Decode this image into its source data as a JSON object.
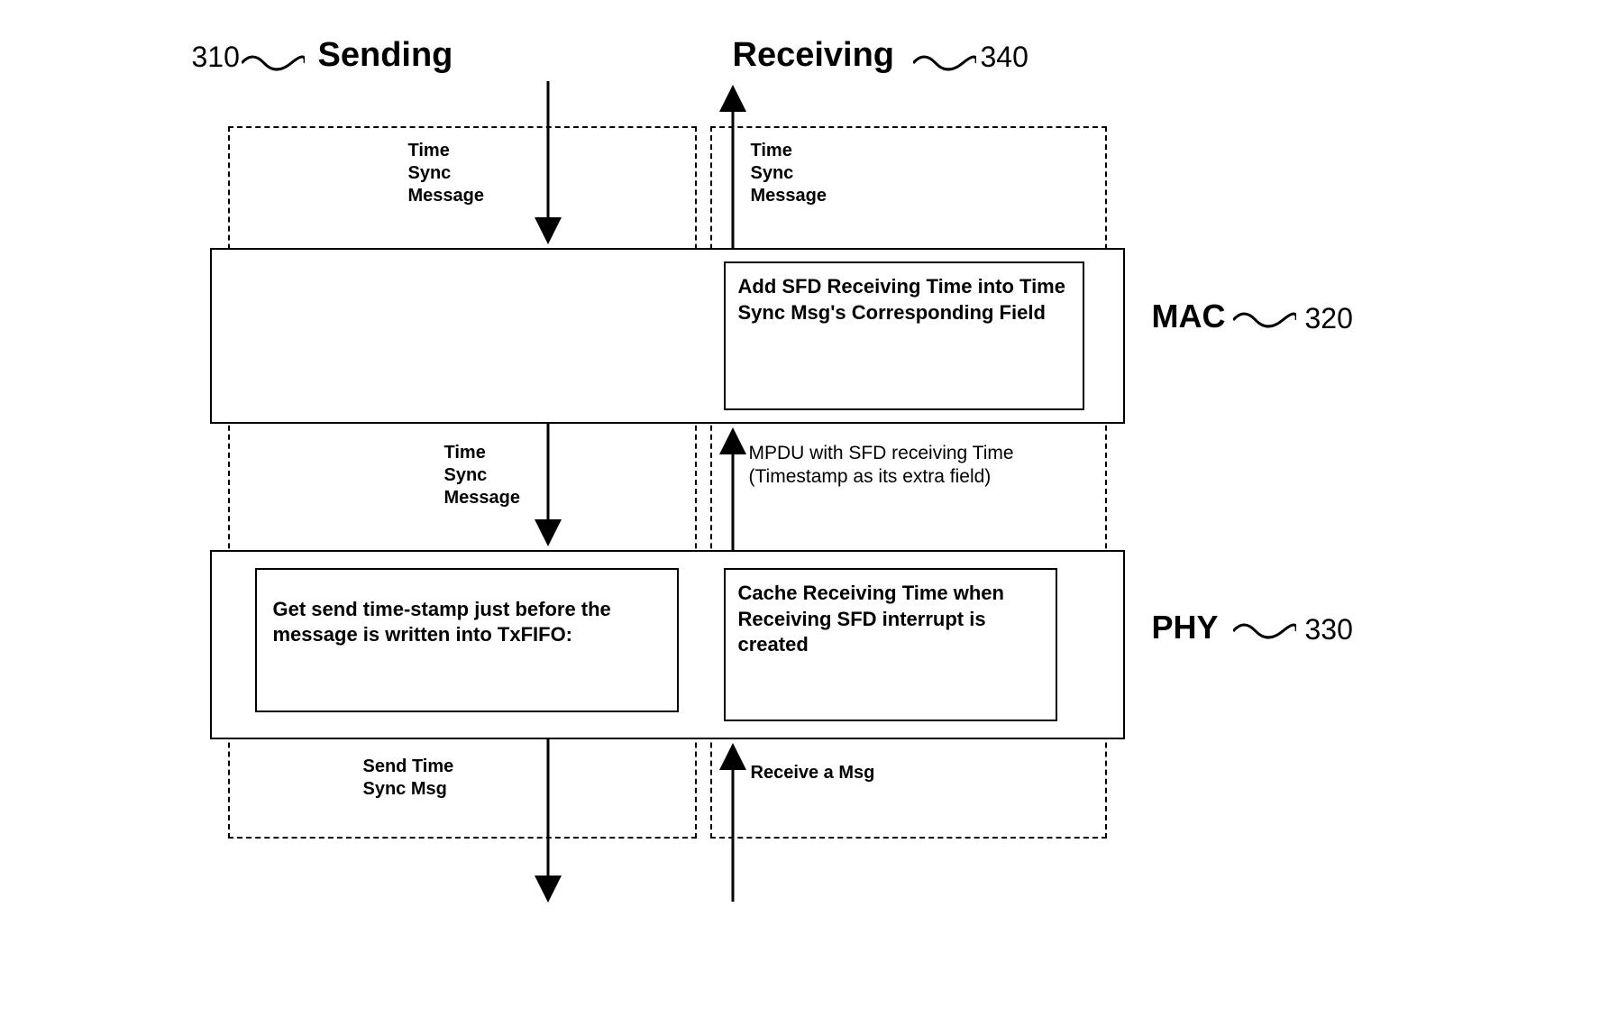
{
  "refs": {
    "r310": "310",
    "r320": "320",
    "r330": "330",
    "r340": "340"
  },
  "titles": {
    "sending": "Sending",
    "receiving": "Receiving",
    "mac": "MAC",
    "phy": "PHY"
  },
  "labels": {
    "time_sync_message": "Time\nSync\nMessage",
    "mpdu_text": "MPDU with SFD receiving Time (Timestamp as its extra field)",
    "send_bottom": "Send Time\nSync Msg",
    "recv_bottom": "Receive a Msg"
  },
  "boxes": {
    "mac_recv": "Add SFD Receiving Time  into Time Sync Msg's Corresponding Field",
    "phy_send": "Get send time-stamp just before the message is written into TxFIFO:",
    "phy_recv": "Cache Receiving Time when Receiving SFD interrupt is created"
  }
}
